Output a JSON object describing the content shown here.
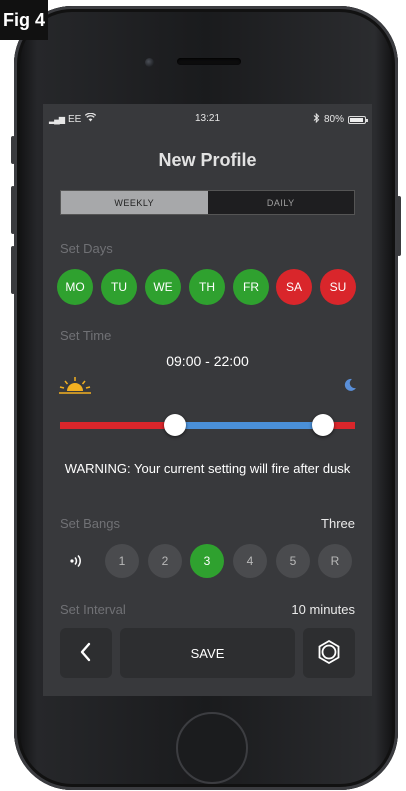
{
  "figure_label": "Fig 4",
  "status_bar": {
    "carrier": "EE",
    "time": "13:21",
    "battery": "80%"
  },
  "screen_title": "New Profile",
  "tabs": [
    {
      "label": "WEEKLY",
      "active": true
    },
    {
      "label": "DAILY",
      "active": false
    }
  ],
  "set_days": {
    "label": "Set Days",
    "days": [
      {
        "label": "MO",
        "enabled": true
      },
      {
        "label": "TU",
        "enabled": true
      },
      {
        "label": "WE",
        "enabled": true
      },
      {
        "label": "TH",
        "enabled": true
      },
      {
        "label": "FR",
        "enabled": true
      },
      {
        "label": "SA",
        "enabled": false
      },
      {
        "label": "SU",
        "enabled": false
      }
    ]
  },
  "set_time": {
    "label": "Set Time",
    "range": "09:00 - 22:00",
    "slider_start_fraction": 0.39,
    "slider_end_fraction": 0.89
  },
  "warning": "WARNING: Your current setting will fire after dusk",
  "set_bangs": {
    "label": "Set Bangs",
    "value": "Three",
    "options": [
      "1",
      "2",
      "3",
      "4",
      "5",
      "R"
    ],
    "selected": "3"
  },
  "set_interval": {
    "label": "Set Interval",
    "value": "10 minutes"
  },
  "buttons": {
    "save": "SAVE"
  },
  "colors": {
    "day_on": "#2fa12f",
    "day_off": "#d9262b",
    "slider_active": "#4a90d9",
    "slider_inactive": "#d9262b",
    "sun": "#f2b021",
    "moon": "#5a8fd8"
  },
  "icons": {
    "back": "chevron-left-icon",
    "settings": "gear-icon",
    "sun": "sunrise-icon",
    "moon": "moon-icon",
    "bangs": "sound-waves-icon"
  }
}
